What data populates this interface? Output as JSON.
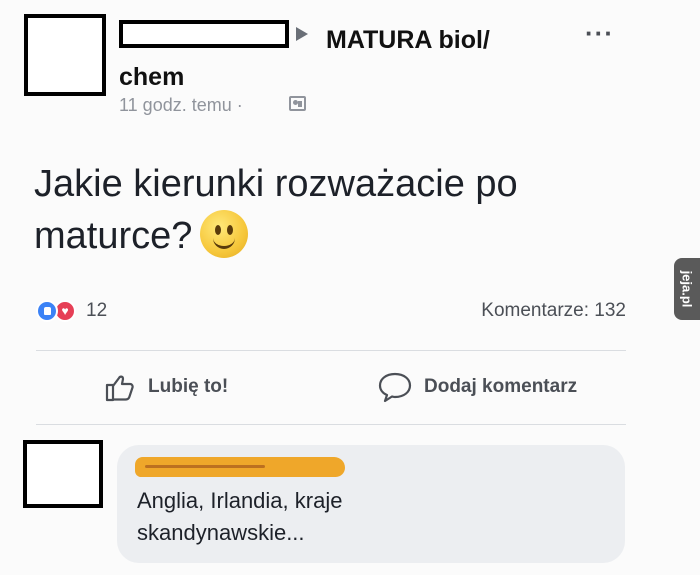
{
  "post": {
    "group_name": "MATURA biol/ chem",
    "timestamp": "11 godz. temu ·",
    "more_label": "···",
    "text": "Jakie kierunki rozważacie po maturce?"
  },
  "stats": {
    "reaction_count": "12",
    "comments_label": "Komentarze: 132"
  },
  "actions": {
    "like_label": "Lubię to!",
    "comment_label": "Dodaj komentarz"
  },
  "comment": {
    "text": "Anglia, Irlandia, kraje skandynawskie..."
  },
  "watermark": {
    "text": "jeja.pl"
  },
  "icons": {
    "arrow": "caret-right-icon",
    "audience": "audience-icon",
    "emoji": "smiley-emoji-icon",
    "like_reaction": "like-reaction-icon",
    "love_reaction": "love-reaction-icon",
    "like_button": "thumbs-up-icon",
    "comment_button": "speech-bubble-icon"
  },
  "colors": {
    "like_blue": "#3b82f6",
    "love_red": "#e63f56",
    "redaction_orange": "#f0a21a"
  }
}
